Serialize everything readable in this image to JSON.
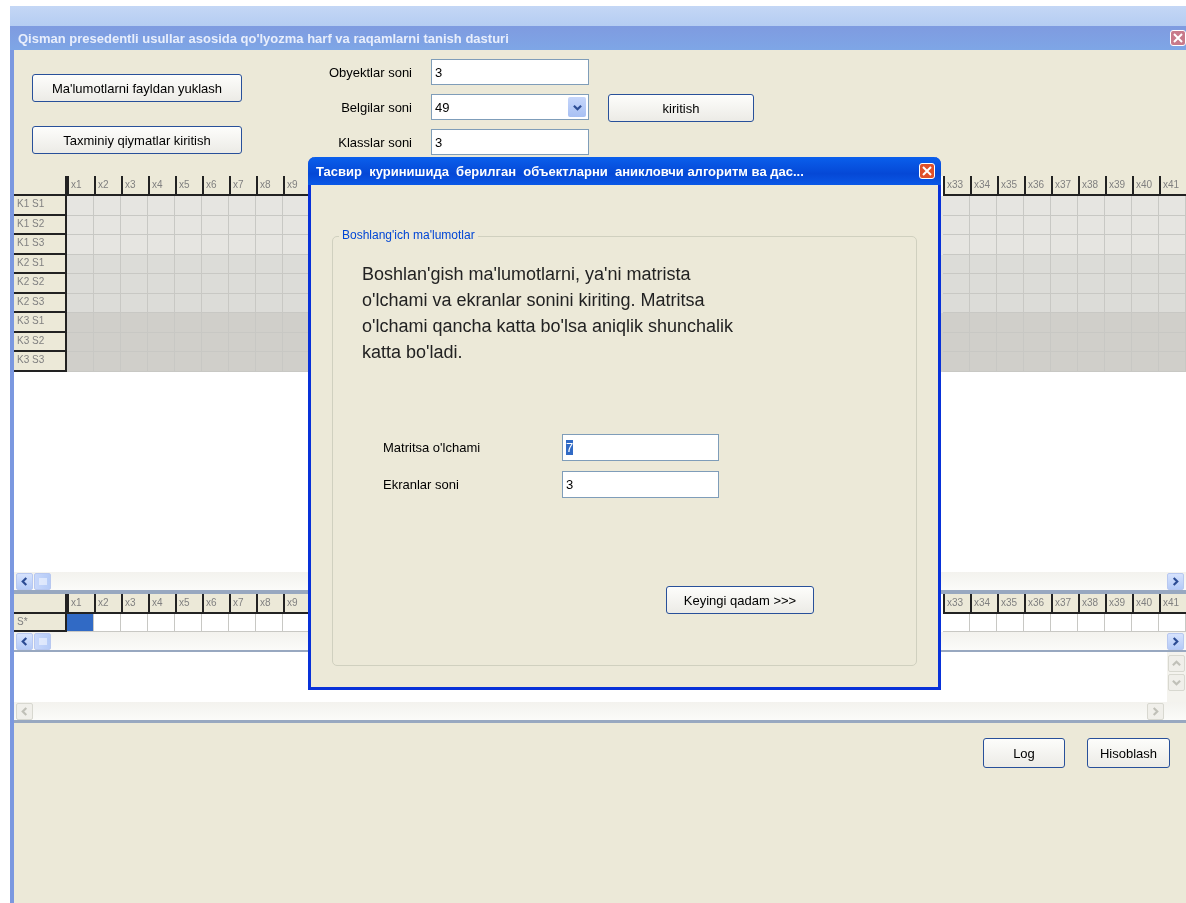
{
  "window": {
    "title": "Qisman presedentli usullar asosida qo'lyozma harf va raqamlarni tanish dasturi"
  },
  "top_buttons": [
    "Ma'lumotlarni fayldan yuklash",
    "Taxminiy qiymatlar kiritish"
  ],
  "fields": [
    {
      "label": "Obyektlar soni",
      "value": "3",
      "kind": "text"
    },
    {
      "label": "Belgilar soni",
      "value": "49",
      "kind": "combo"
    },
    {
      "label": "Klasslar soni",
      "value": "3",
      "kind": "text"
    }
  ],
  "enter_button": "kiritish",
  "grid": {
    "columns_left": [
      "x1",
      "x2",
      "x3",
      "x4",
      "x5",
      "x6",
      "x7",
      "x8",
      "x9"
    ],
    "columns_right": [
      "x33",
      "x34",
      "x35",
      "x36",
      "x37",
      "x38",
      "x39",
      "x40",
      "x41"
    ],
    "rows": [
      {
        "label": "K1 S1",
        "color": "#e6e5e1"
      },
      {
        "label": "K1 S2",
        "color": "#e6e5e1"
      },
      {
        "label": "K1 S3",
        "color": "#e6e5e1"
      },
      {
        "label": "K2 S1",
        "color": "#dcdcd8"
      },
      {
        "label": "K2 S2",
        "color": "#dcdcd8"
      },
      {
        "label": "K2 S3",
        "color": "#dcdcd8"
      },
      {
        "label": "K3 S1",
        "color": "#d0cfca"
      },
      {
        "label": "K3 S2",
        "color": "#d0cfca"
      },
      {
        "label": "K3 S3",
        "color": "#d0cfca"
      }
    ]
  },
  "result_grid": {
    "columns_left": [
      "x1",
      "x2",
      "x3",
      "x4",
      "x5",
      "x6",
      "x7",
      "x8",
      "x9"
    ],
    "columns_right": [
      "x33",
      "x34",
      "x35",
      "x36",
      "x37",
      "x38",
      "x39",
      "x40",
      "x41"
    ],
    "row": {
      "label": "S*",
      "cells": [
        {
          "selected": true
        },
        {
          "selected": false
        },
        {
          "selected": false
        },
        {
          "selected": false
        },
        {
          "selected": false
        },
        {
          "selected": false
        },
        {
          "selected": false
        },
        {
          "selected": false
        },
        {
          "selected": false
        },
        {
          "selected": false
        },
        {
          "selected": false
        },
        {
          "selected": false
        },
        {
          "selected": false
        },
        {
          "selected": false
        },
        {
          "selected": false
        },
        {
          "selected": false
        },
        {
          "selected": false
        },
        {
          "selected": false
        }
      ]
    }
  },
  "bottom_buttons": [
    "Log",
    "Hisoblash"
  ],
  "dialog": {
    "title": "Тасвир  куринишида  берилган  объектларни  аникловчи алгоритм ва дас...",
    "group_title": "Boshlang'ich ma'lumotlar",
    "description": "Boshlan'gish ma'lumotlarni, ya'ni matrista o'lchami va ekranlar sonini kiriting. Matritsa o'lchami qancha katta bo'lsa aniqlik shunchalik katta bo'ladi.",
    "fields": [
      {
        "label": "Matritsa o'lchami",
        "value": "7",
        "text_selected": true
      },
      {
        "label": "Ekranlar soni",
        "value": "3",
        "text_selected": false
      }
    ],
    "next_button": "Keyingi qadam >>>"
  }
}
